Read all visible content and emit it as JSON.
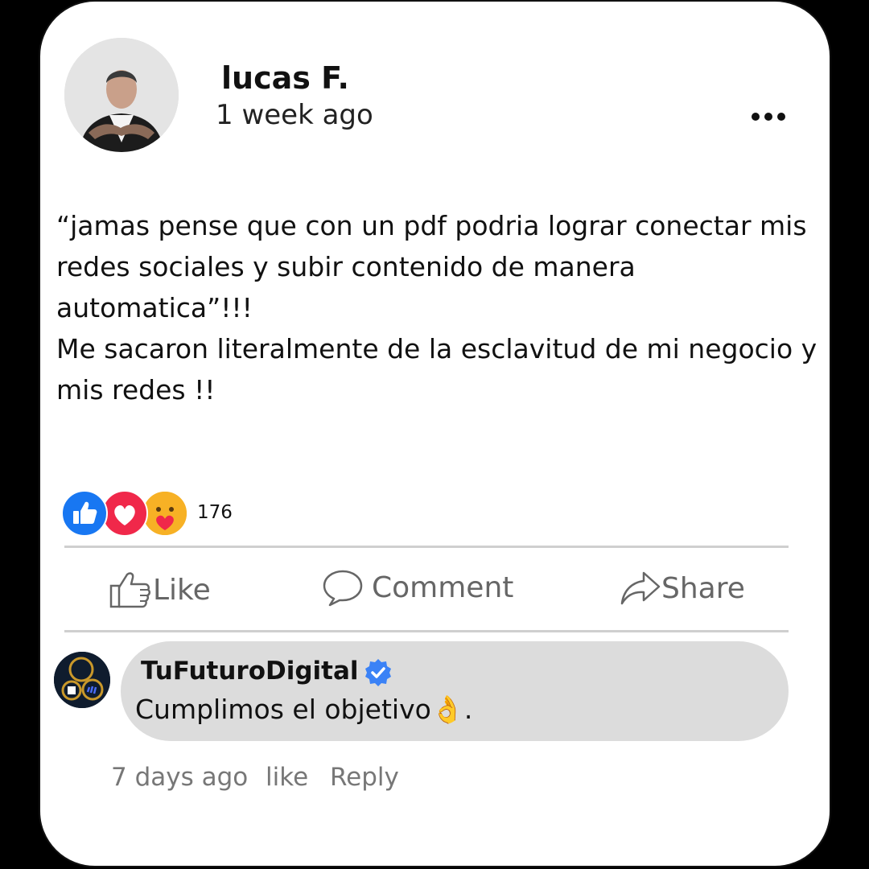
{
  "post": {
    "author": "lucas F.",
    "time": "1 week ago",
    "text_lines": [
      "“jamas pense que con un pdf podria lograr conectar mis redes sociales y subir contenido de manera automatica”!!!",
      "Me sacaron literalmente de la esclavitud de mi negocio y mis redes !!"
    ],
    "reaction_count": "176",
    "reactions": [
      "like-icon",
      "love-icon",
      "care-icon"
    ]
  },
  "actions": {
    "like": "Like",
    "comment": "Comment",
    "share": "Share"
  },
  "comment": {
    "author": "TuFuturoDigital",
    "verified": true,
    "text": "Cumplimos el objetivo👌.",
    "time": "7 days ago",
    "like_label": "like",
    "reply_label": "Reply"
  },
  "colors": {
    "like_blue": "#1877f2",
    "love_red": "#f0284a",
    "care_yellow": "#f7b125",
    "verified_blue": "#3b82f6",
    "muted_text": "#777777",
    "bubble": "#dcdcdc"
  }
}
